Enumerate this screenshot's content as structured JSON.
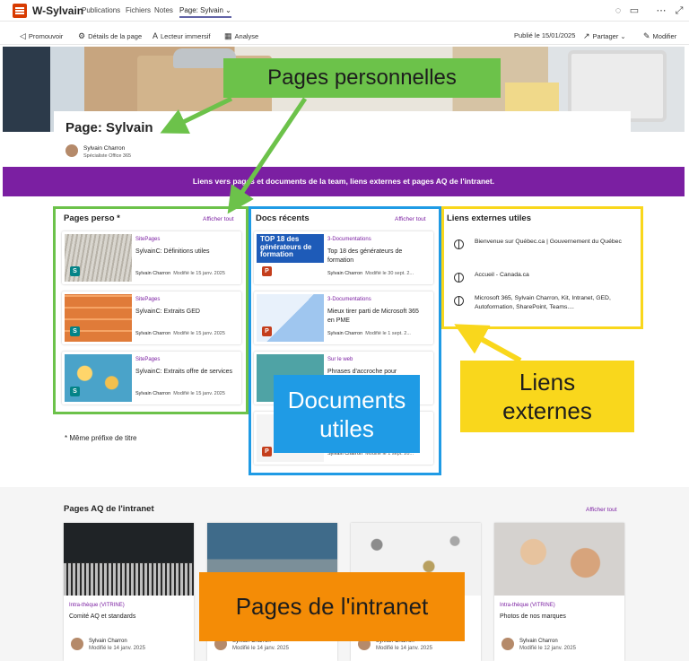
{
  "topbar": {
    "site_name": "W-Sylvain",
    "tabs": [
      {
        "label": "Publications"
      },
      {
        "label": "Fichiers"
      },
      {
        "label": "Notes"
      },
      {
        "label": "Page: Sylvain"
      }
    ]
  },
  "commandbar": {
    "promote": "Promouvoir",
    "page_details": "Détails de la page",
    "immersive_reader": "Lecteur immersif",
    "analytics": "Analyse",
    "published": "Publié le 15/01/2025",
    "share": "Partager",
    "edit": "Modifier"
  },
  "header": {
    "title": "Page: Sylvain",
    "author": "Sylvain Charron",
    "role": "Spécialiste Office 365"
  },
  "banner_text": "Liens vers pages et documents de la team, liens externes et pages AQ de l'intranet.",
  "pages_perso": {
    "title": "Pages perso *",
    "see_all": "Afficher tout",
    "note": "* Même préfixe de titre",
    "items": [
      {
        "tag": "SitePages",
        "title": "SylvainC: Définitions utiles",
        "author": "Sylvain Charron",
        "date": "Modifié le 15 janv. 2025"
      },
      {
        "tag": "SitePages",
        "title": "SylvainC: Extraits GED",
        "author": "Sylvain Charron",
        "date": "Modifié le 15 janv. 2025"
      },
      {
        "tag": "SitePages",
        "title": "SylvainC: Extraits offre de services",
        "author": "Sylvain Charron",
        "date": "Modifié le 15 janv. 2025"
      }
    ]
  },
  "docs_recents": {
    "title": "Docs récents",
    "see_all": "Afficher tout",
    "thumb_text": "TOP 18 des générateurs de formation",
    "items": [
      {
        "tag": "3-Documentations",
        "title": "Top 18 des générateurs de formation",
        "author": "Sylvain Charron",
        "date": "Modifié le 30 sept. 2..."
      },
      {
        "tag": "3-Documentations",
        "title": "Mieux tirer parti de Microsoft 365 en PME",
        "author": "Sylvain Charron",
        "date": "Modifié le 1 sept. 2..."
      },
      {
        "tag": "Sur le web",
        "title": "Phrases d'accroche pour",
        "author": "",
        "date": ""
      },
      {
        "tag": "",
        "title": "",
        "author": "Sylvain Charron",
        "date": "Modifié le 1 sept. 20..."
      }
    ]
  },
  "liens_externes": {
    "title": "Liens externes utiles",
    "items": [
      {
        "label": "Bienvenue sur Québec.ca | Gouvernement du Québec"
      },
      {
        "label": "Accueil - Canada.ca"
      },
      {
        "label": "Microsoft 365, Sylvain Charron, Kit, Intranet, GED, Autoformation, SharePoint, Teams...."
      }
    ]
  },
  "aq": {
    "title": "Pages AQ de l'intranet",
    "see_all": "Afficher tout",
    "items": [
      {
        "tag": "Intra-thèque (VITRINE)",
        "title": "Comité AQ et standards",
        "author": "Sylvain Charron",
        "date": "Modifié le 14 janv. 2025"
      },
      {
        "tag": "",
        "title": "",
        "author": "Sylvain Charron",
        "date": "Modifié le 14 janv. 2025"
      },
      {
        "tag": "",
        "title": "",
        "author": "Sylvain Charron",
        "date": "Modifié le 14 janv. 2025"
      },
      {
        "tag": "Intra-thèque (VITRINE)",
        "title": "Photos de nos marques",
        "author": "Sylvain Charron",
        "date": "Modifié le 12 janv. 2025"
      }
    ]
  },
  "callouts": {
    "pages_perso": "Pages personnelles",
    "docs_line1": "Documents",
    "docs_line2": "utiles",
    "links_line1": "Liens",
    "links_line2": "externes",
    "intranet": "Pages de l'intranet"
  },
  "colors": {
    "accent": "#7b1fa2",
    "green_frame": "#6cc24a",
    "blue_frame": "#1f9be5",
    "yellow_frame": "#f9d71c",
    "orange_callout": "#f48c06"
  },
  "icons": [
    "app-logo-icon",
    "chat-icon",
    "video-icon",
    "more-icon",
    "expand-icon",
    "megaphone-icon",
    "gear-icon",
    "reader-icon",
    "analytics-icon",
    "share-icon",
    "pencil-icon",
    "globe-icon"
  ]
}
